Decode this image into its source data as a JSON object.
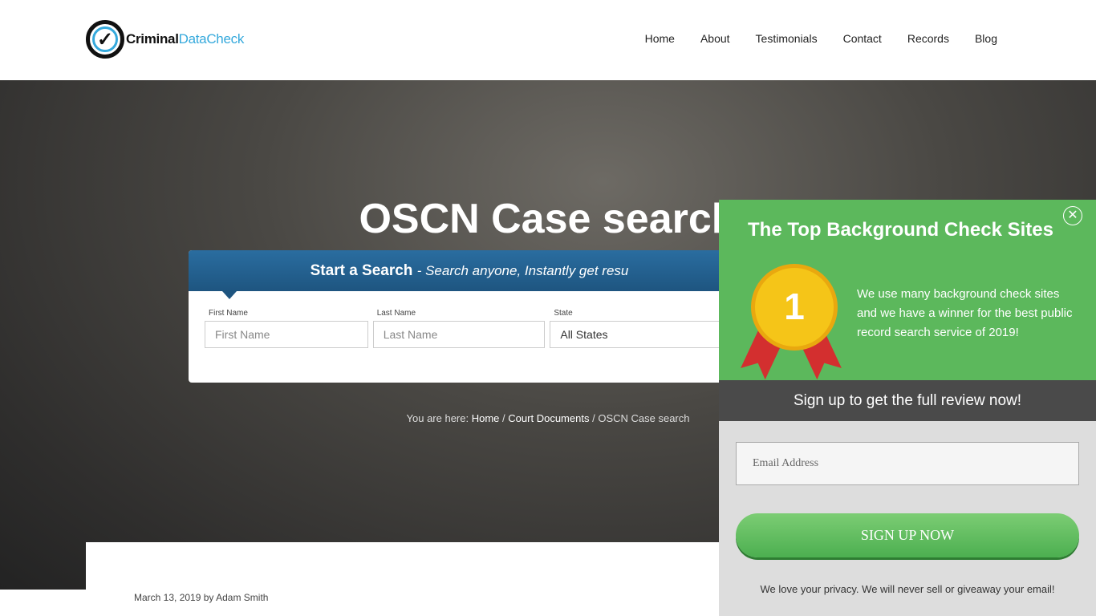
{
  "header": {
    "logo": {
      "bold": "Criminal",
      "light": "DataCheck"
    },
    "nav": [
      "Home",
      "About",
      "Testimonials",
      "Contact",
      "Records",
      "Blog"
    ]
  },
  "hero": {
    "title": "OSCN Case search",
    "search": {
      "title": "Start a Search",
      "subtitle": "- Search anyone, Instantly get resu",
      "first_label": "First Name",
      "first_placeholder": "First Name",
      "last_label": "Last Name",
      "last_placeholder": "Last Name",
      "state_label": "State",
      "state_value": "All States"
    },
    "breadcrumb": {
      "prefix": "You are here:",
      "items": [
        "Home",
        "Court Documents"
      ],
      "current": "OSCN Case search",
      "sep": "/"
    }
  },
  "post": {
    "date": "March 13, 2019",
    "by": "by",
    "author": "Adam Smith"
  },
  "popup": {
    "title": "The Top Background Check Sites",
    "badge": "1",
    "text": "We use many background check sites and we have a winner for the best public record search service of 2019!",
    "band": "Sign up to get the full review now!",
    "email_placeholder": "Email Address",
    "button": "SIGN UP NOW",
    "privacy": "We love your privacy.  We will never sell or giveaway your email!",
    "colors": {
      "green": "#5cb85c",
      "band": "#4a4a4a"
    }
  }
}
